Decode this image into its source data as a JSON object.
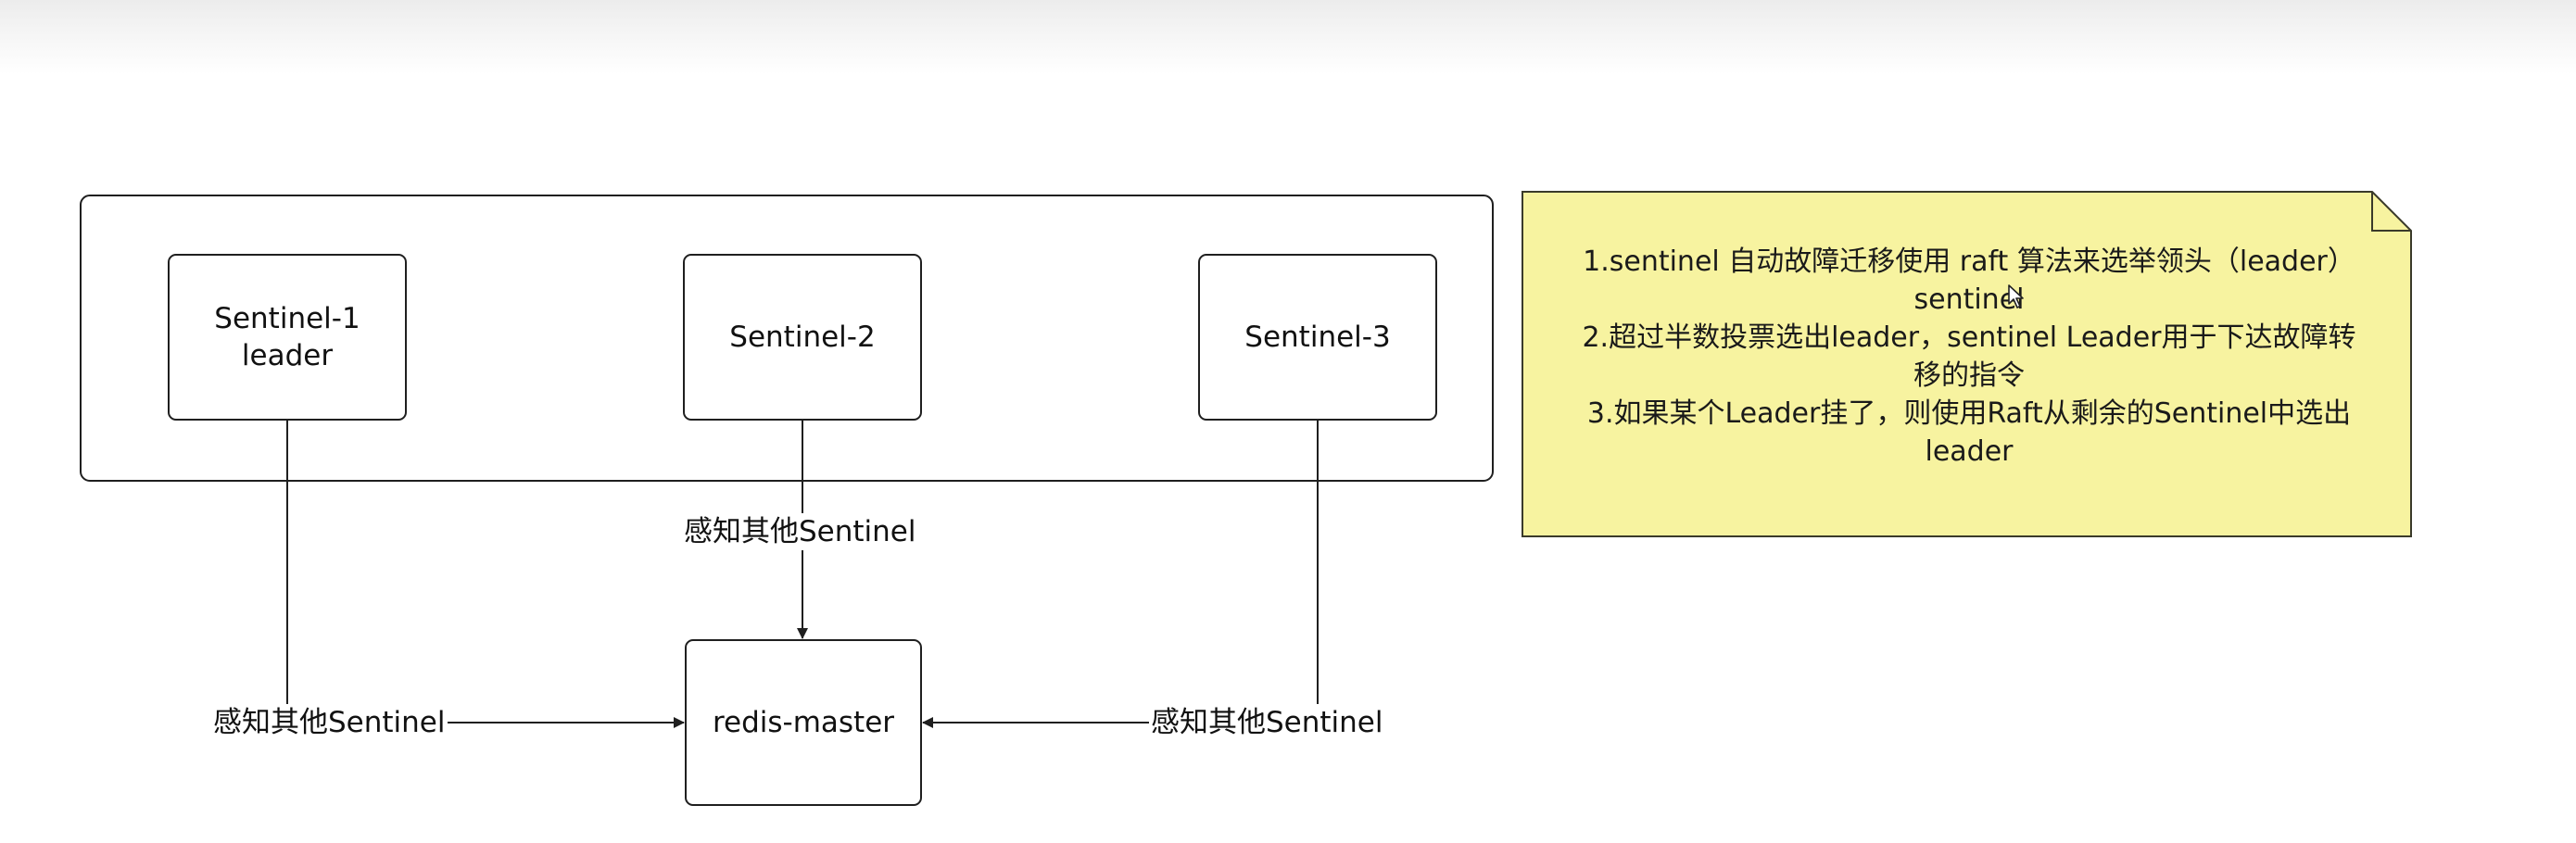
{
  "nodes": {
    "sentinel1": {
      "label": "Sentinel-1\nleader"
    },
    "sentinel2": {
      "label": "Sentinel-2"
    },
    "sentinel3": {
      "label": "Sentinel-3"
    },
    "redis_master": {
      "label": "redis-master"
    }
  },
  "edges": {
    "left_label": "感知其他Sentinel",
    "middle_label": "感知其他Sentinel",
    "right_label": "感知其他Sentinel"
  },
  "note": {
    "lines": [
      "1.sentinel 自动故障迁移使用 raft 算法来选举领头（leader）",
      "sentinel",
      "2.超过半数投票选出leader，sentinel Leader用于下达故障转",
      "移的指令",
      "3.如果某个Leader挂了，则使用Raft从剩余的Sentinel中选出",
      "leader"
    ]
  },
  "colors": {
    "stroke": "#1f1f1f",
    "note_fill": "#f7f3a0",
    "note_stroke": "#3a3a2a",
    "label_text": "#111111"
  },
  "icons": {
    "cursor": "mouse-pointer-icon"
  }
}
